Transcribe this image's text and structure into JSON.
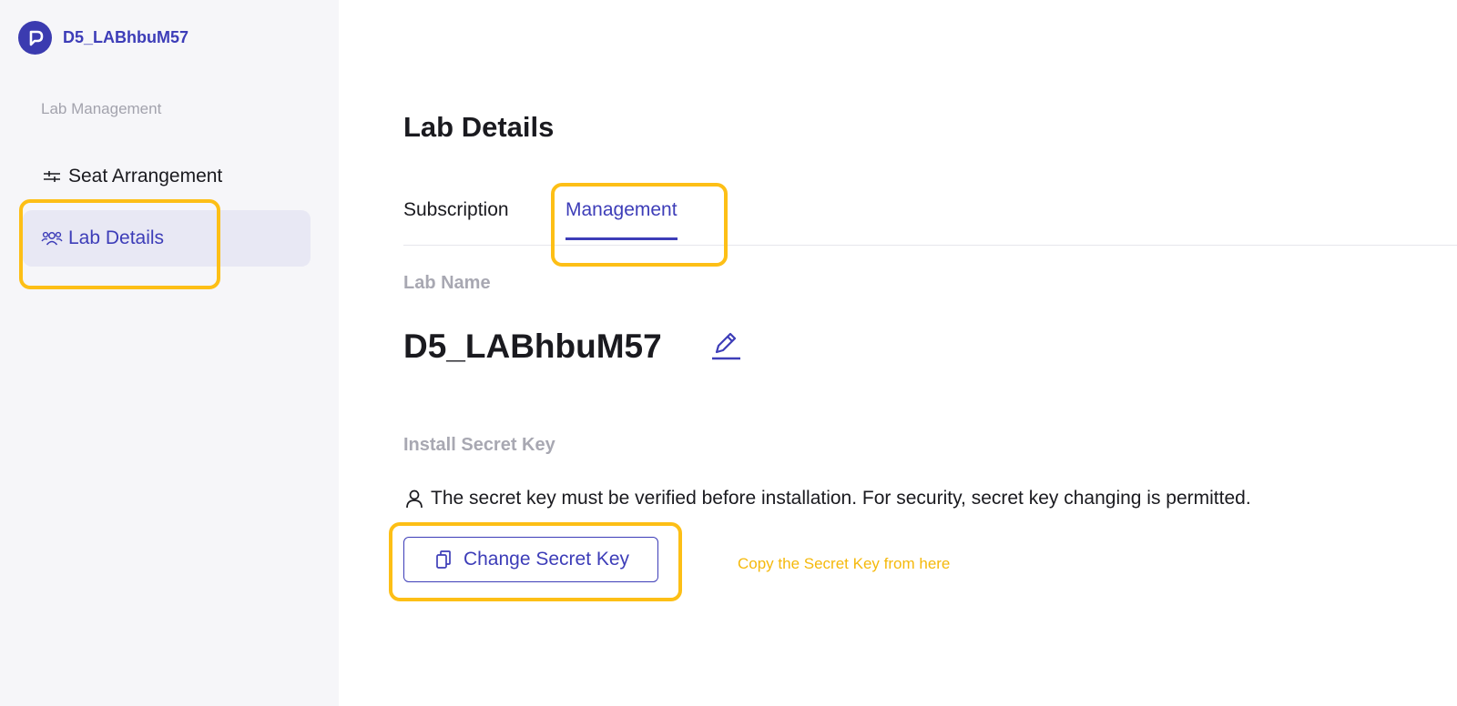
{
  "brand": {
    "name": "D5_LABhbuM57",
    "logo_icon": "brand-logo-icon",
    "color": "#3b3bb0"
  },
  "sidebar": {
    "section_label": "Lab Management",
    "items": [
      {
        "label": "Seat Arrangement",
        "icon": "sliders-icon",
        "active": false
      },
      {
        "label": "Lab Details",
        "icon": "users-icon",
        "active": true
      }
    ]
  },
  "main": {
    "title": "Lab Details",
    "tabs": [
      {
        "label": "Subscription",
        "active": false
      },
      {
        "label": "Management",
        "active": true
      }
    ],
    "lab_name": {
      "label": "Lab Name",
      "value": "D5_LABhbuM57",
      "edit_icon": "pencil-icon"
    },
    "secret_key": {
      "label": "Install Secret Key",
      "notice": "The secret key must be verified before installation. For security, secret key changing is permitted.",
      "notice_icon": "person-icon",
      "button_label": "Change Secret Key",
      "button_icon": "copy-icon"
    }
  },
  "annotations": {
    "highlight_color": "#fdbf16",
    "note": "Copy the Secret Key from here"
  },
  "colors": {
    "accent": "#3d3db8",
    "sidebar_bg": "#f6f6f9",
    "active_item_bg": "#e8e8f4",
    "muted_text": "#a8a8b2"
  }
}
